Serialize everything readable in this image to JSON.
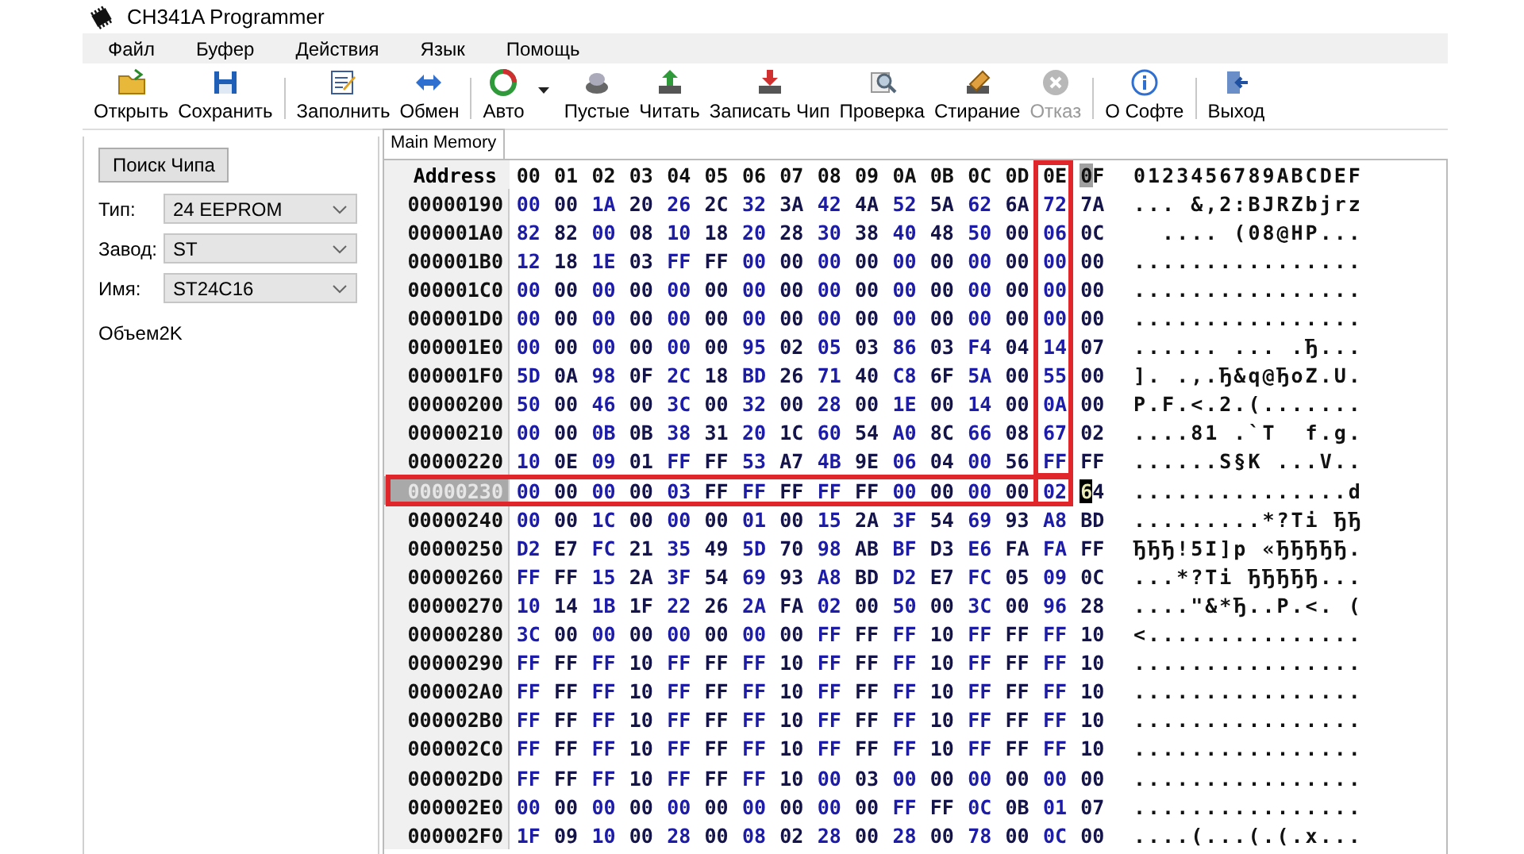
{
  "window": {
    "title": "CH341A Programmer"
  },
  "menu": [
    "Файл",
    "Буфер",
    "Действия",
    "Язык",
    "Помощь"
  ],
  "toolbar": [
    [
      {
        "label": "Открыть",
        "disabled": false,
        "dropdown": false
      },
      {
        "label": "Сохранить",
        "disabled": false,
        "dropdown": false
      }
    ],
    [
      {
        "label": "Заполнить",
        "disabled": false,
        "dropdown": false
      },
      {
        "label": "Обмен",
        "disabled": false,
        "dropdown": false
      }
    ],
    [
      {
        "label": "Авто",
        "disabled": false,
        "dropdown": true
      },
      {
        "label": "Пустые",
        "disabled": false,
        "dropdown": false
      },
      {
        "label": "Читать",
        "disabled": false,
        "dropdown": false
      },
      {
        "label": "Записать Чип",
        "disabled": false,
        "dropdown": false
      },
      {
        "label": "Проверка",
        "disabled": false,
        "dropdown": false
      },
      {
        "label": "Стирание",
        "disabled": false,
        "dropdown": false
      },
      {
        "label": "Отказ",
        "disabled": true,
        "dropdown": false
      }
    ],
    [
      {
        "label": "О Софте",
        "disabled": false,
        "dropdown": false
      }
    ],
    [
      {
        "label": "Выход",
        "disabled": false,
        "dropdown": false
      }
    ]
  ],
  "chip_panel": {
    "search_button": "Поиск Чипа",
    "fields": [
      {
        "label": "Тип:",
        "value": "24 EEPROM"
      },
      {
        "label": "Завод:",
        "value": "ST"
      },
      {
        "label": "Имя:",
        "value": "ST24C16"
      }
    ],
    "capacity": "Объем2K"
  },
  "tabs": [
    {
      "label": "Main Memory",
      "selected": true
    }
  ],
  "hex_view": {
    "address_header": "Address",
    "ascii_header": "0123456789ABCDEF",
    "columns": [
      {
        "label": "00",
        "boxed": false,
        "cursor": false
      },
      {
        "label": "01",
        "boxed": false,
        "cursor": false
      },
      {
        "label": "02",
        "boxed": false,
        "cursor": false
      },
      {
        "label": "03",
        "boxed": false,
        "cursor": false
      },
      {
        "label": "04",
        "boxed": false,
        "cursor": false
      },
      {
        "label": "05",
        "boxed": false,
        "cursor": false
      },
      {
        "label": "06",
        "boxed": false,
        "cursor": false
      },
      {
        "label": "07",
        "boxed": false,
        "cursor": false
      },
      {
        "label": "08",
        "boxed": false,
        "cursor": false
      },
      {
        "label": "09",
        "boxed": false,
        "cursor": false
      },
      {
        "label": "0A",
        "boxed": false,
        "cursor": false
      },
      {
        "label": "0B",
        "boxed": false,
        "cursor": false
      },
      {
        "label": "0C",
        "boxed": false,
        "cursor": false
      },
      {
        "label": "0D",
        "boxed": false,
        "cursor": false
      },
      {
        "label": "0E",
        "boxed": true,
        "cursor": false
      },
      {
        "label": "0F",
        "boxed": false,
        "cursor": true
      }
    ],
    "rows": [
      {
        "address": "00000190",
        "selected": false,
        "boxed": false,
        "cursor": false,
        "bytes": [
          "00",
          "00",
          "1A",
          "20",
          "26",
          "2C",
          "32",
          "3A",
          "42",
          "4A",
          "52",
          "5A",
          "62",
          "6A",
          "72",
          "7A"
        ],
        "ascii": "... &,2:BJRZbjrz"
      },
      {
        "address": "000001A0",
        "selected": false,
        "boxed": false,
        "cursor": false,
        "bytes": [
          "82",
          "82",
          "00",
          "08",
          "10",
          "18",
          "20",
          "28",
          "30",
          "38",
          "40",
          "48",
          "50",
          "00",
          "06",
          "0C"
        ],
        "ascii": "  .... (08@HP..."
      },
      {
        "address": "000001B0",
        "selected": false,
        "boxed": false,
        "cursor": false,
        "bytes": [
          "12",
          "18",
          "1E",
          "03",
          "FF",
          "FF",
          "00",
          "00",
          "00",
          "00",
          "00",
          "00",
          "00",
          "00",
          "00",
          "00"
        ],
        "ascii": "................"
      },
      {
        "address": "000001C0",
        "selected": false,
        "boxed": false,
        "cursor": false,
        "bytes": [
          "00",
          "00",
          "00",
          "00",
          "00",
          "00",
          "00",
          "00",
          "00",
          "00",
          "00",
          "00",
          "00",
          "00",
          "00",
          "00"
        ],
        "ascii": "................"
      },
      {
        "address": "000001D0",
        "selected": false,
        "boxed": false,
        "cursor": false,
        "bytes": [
          "00",
          "00",
          "00",
          "00",
          "00",
          "00",
          "00",
          "00",
          "00",
          "00",
          "00",
          "00",
          "00",
          "00",
          "00",
          "00"
        ],
        "ascii": "................"
      },
      {
        "address": "000001E0",
        "selected": false,
        "boxed": false,
        "cursor": false,
        "bytes": [
          "00",
          "00",
          "00",
          "00",
          "00",
          "00",
          "95",
          "02",
          "05",
          "03",
          "86",
          "03",
          "F4",
          "04",
          "14",
          "07"
        ],
        "ascii": "...... ... .Ђ..."
      },
      {
        "address": "000001F0",
        "selected": false,
        "boxed": false,
        "cursor": false,
        "bytes": [
          "5D",
          "0A",
          "98",
          "0F",
          "2C",
          "18",
          "BD",
          "26",
          "71",
          "40",
          "C8",
          "6F",
          "5A",
          "00",
          "55",
          "00"
        ],
        "ascii": "]. .,.Ђ&q@ЂoZ.U."
      },
      {
        "address": "00000200",
        "selected": false,
        "boxed": false,
        "cursor": false,
        "bytes": [
          "50",
          "00",
          "46",
          "00",
          "3C",
          "00",
          "32",
          "00",
          "28",
          "00",
          "1E",
          "00",
          "14",
          "00",
          "0A",
          "00"
        ],
        "ascii": "P.F.<.2.(......."
      },
      {
        "address": "00000210",
        "selected": false,
        "boxed": false,
        "cursor": false,
        "bytes": [
          "00",
          "00",
          "0B",
          "0B",
          "38",
          "31",
          "20",
          "1C",
          "60",
          "54",
          "A0",
          "8C",
          "66",
          "08",
          "67",
          "02"
        ],
        "ascii": "....81 .`T  f.g."
      },
      {
        "address": "00000220",
        "selected": false,
        "boxed": false,
        "cursor": false,
        "bytes": [
          "10",
          "0E",
          "09",
          "01",
          "FF",
          "FF",
          "53",
          "A7",
          "4B",
          "9E",
          "06",
          "04",
          "00",
          "56",
          "FF",
          "FF"
        ],
        "ascii": "......S§K ...V.."
      },
      {
        "address": "00000230",
        "selected": true,
        "boxed": true,
        "cursor": true,
        "bytes": [
          "00",
          "00",
          "00",
          "00",
          "03",
          "FF",
          "FF",
          "FF",
          "FF",
          "FF",
          "00",
          "00",
          "00",
          "00",
          "02",
          "64"
        ],
        "ascii": "...............d"
      },
      {
        "address": "00000240",
        "selected": false,
        "boxed": false,
        "cursor": false,
        "bytes": [
          "00",
          "00",
          "1C",
          "00",
          "00",
          "00",
          "01",
          "00",
          "15",
          "2A",
          "3F",
          "54",
          "69",
          "93",
          "A8",
          "BD"
        ],
        "ascii": ".........*?Ti ЂЂ"
      },
      {
        "address": "00000250",
        "selected": false,
        "boxed": false,
        "cursor": false,
        "bytes": [
          "D2",
          "E7",
          "FC",
          "21",
          "35",
          "49",
          "5D",
          "70",
          "98",
          "AB",
          "BF",
          "D3",
          "E6",
          "FA",
          "FA",
          "FF"
        ],
        "ascii": "ЂЂЂ!5I]p «ЂЂЂЂЂ."
      },
      {
        "address": "00000260",
        "selected": false,
        "boxed": false,
        "cursor": false,
        "bytes": [
          "FF",
          "FF",
          "15",
          "2A",
          "3F",
          "54",
          "69",
          "93",
          "A8",
          "BD",
          "D2",
          "E7",
          "FC",
          "05",
          "09",
          "0C"
        ],
        "ascii": "...*?Ti ЂЂЂЂЂ..."
      },
      {
        "address": "00000270",
        "selected": false,
        "boxed": false,
        "cursor": false,
        "bytes": [
          "10",
          "14",
          "1B",
          "1F",
          "22",
          "26",
          "2A",
          "FA",
          "02",
          "00",
          "50",
          "00",
          "3C",
          "00",
          "96",
          "28"
        ],
        "ascii": "....\"&*Ђ..P.<. ("
      },
      {
        "address": "00000280",
        "selected": false,
        "boxed": false,
        "cursor": false,
        "bytes": [
          "3C",
          "00",
          "00",
          "00",
          "00",
          "00",
          "00",
          "00",
          "FF",
          "FF",
          "FF",
          "10",
          "FF",
          "FF",
          "FF",
          "10"
        ],
        "ascii": "<..............."
      },
      {
        "address": "00000290",
        "selected": false,
        "boxed": false,
        "cursor": false,
        "bytes": [
          "FF",
          "FF",
          "FF",
          "10",
          "FF",
          "FF",
          "FF",
          "10",
          "FF",
          "FF",
          "FF",
          "10",
          "FF",
          "FF",
          "FF",
          "10"
        ],
        "ascii": "................"
      },
      {
        "address": "000002A0",
        "selected": false,
        "boxed": false,
        "cursor": false,
        "bytes": [
          "FF",
          "FF",
          "FF",
          "10",
          "FF",
          "FF",
          "FF",
          "10",
          "FF",
          "FF",
          "FF",
          "10",
          "FF",
          "FF",
          "FF",
          "10"
        ],
        "ascii": "................"
      },
      {
        "address": "000002B0",
        "selected": false,
        "boxed": false,
        "cursor": false,
        "bytes": [
          "FF",
          "FF",
          "FF",
          "10",
          "FF",
          "FF",
          "FF",
          "10",
          "FF",
          "FF",
          "FF",
          "10",
          "FF",
          "FF",
          "FF",
          "10"
        ],
        "ascii": "................"
      },
      {
        "address": "000002C0",
        "selected": false,
        "boxed": false,
        "cursor": false,
        "bytes": [
          "FF",
          "FF",
          "FF",
          "10",
          "FF",
          "FF",
          "FF",
          "10",
          "FF",
          "FF",
          "FF",
          "10",
          "FF",
          "FF",
          "FF",
          "10"
        ],
        "ascii": "................"
      },
      {
        "address": "000002D0",
        "selected": false,
        "boxed": false,
        "cursor": false,
        "bytes": [
          "FF",
          "FF",
          "FF",
          "10",
          "FF",
          "FF",
          "FF",
          "10",
          "00",
          "03",
          "00",
          "00",
          "00",
          "00",
          "00",
          "00"
        ],
        "ascii": "................"
      },
      {
        "address": "000002E0",
        "selected": false,
        "boxed": false,
        "cursor": false,
        "bytes": [
          "00",
          "00",
          "00",
          "00",
          "00",
          "00",
          "00",
          "00",
          "00",
          "00",
          "FF",
          "FF",
          "0C",
          "0B",
          "01",
          "07"
        ],
        "ascii": "................"
      },
      {
        "address": "000002F0",
        "selected": false,
        "boxed": false,
        "cursor": false,
        "bytes": [
          "1F",
          "09",
          "10",
          "00",
          "28",
          "00",
          "08",
          "02",
          "28",
          "00",
          "28",
          "00",
          "78",
          "00",
          "0C",
          "00"
        ],
        "ascii": "....(...(.(.x..."
      }
    ]
  }
}
